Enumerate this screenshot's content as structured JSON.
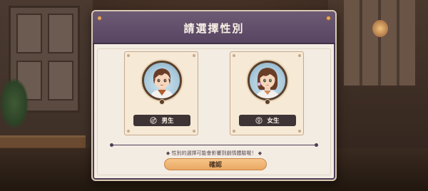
{
  "dialog": {
    "title": "請選擇性別",
    "hint": "◆ 性別的選擇可能會影響到劇情體驗喔！ ◆",
    "confirm_label": "確認"
  },
  "options": [
    {
      "id": "male",
      "label": "男生",
      "icon": "male-symbol-icon"
    },
    {
      "id": "female",
      "label": "女生",
      "icon": "female-symbol-icon"
    }
  ],
  "colors": {
    "header": "#574562",
    "panel": "#f3ece3",
    "card": "#f6e9d6",
    "tag": "#3e3436",
    "confirm": "#eaa864"
  }
}
